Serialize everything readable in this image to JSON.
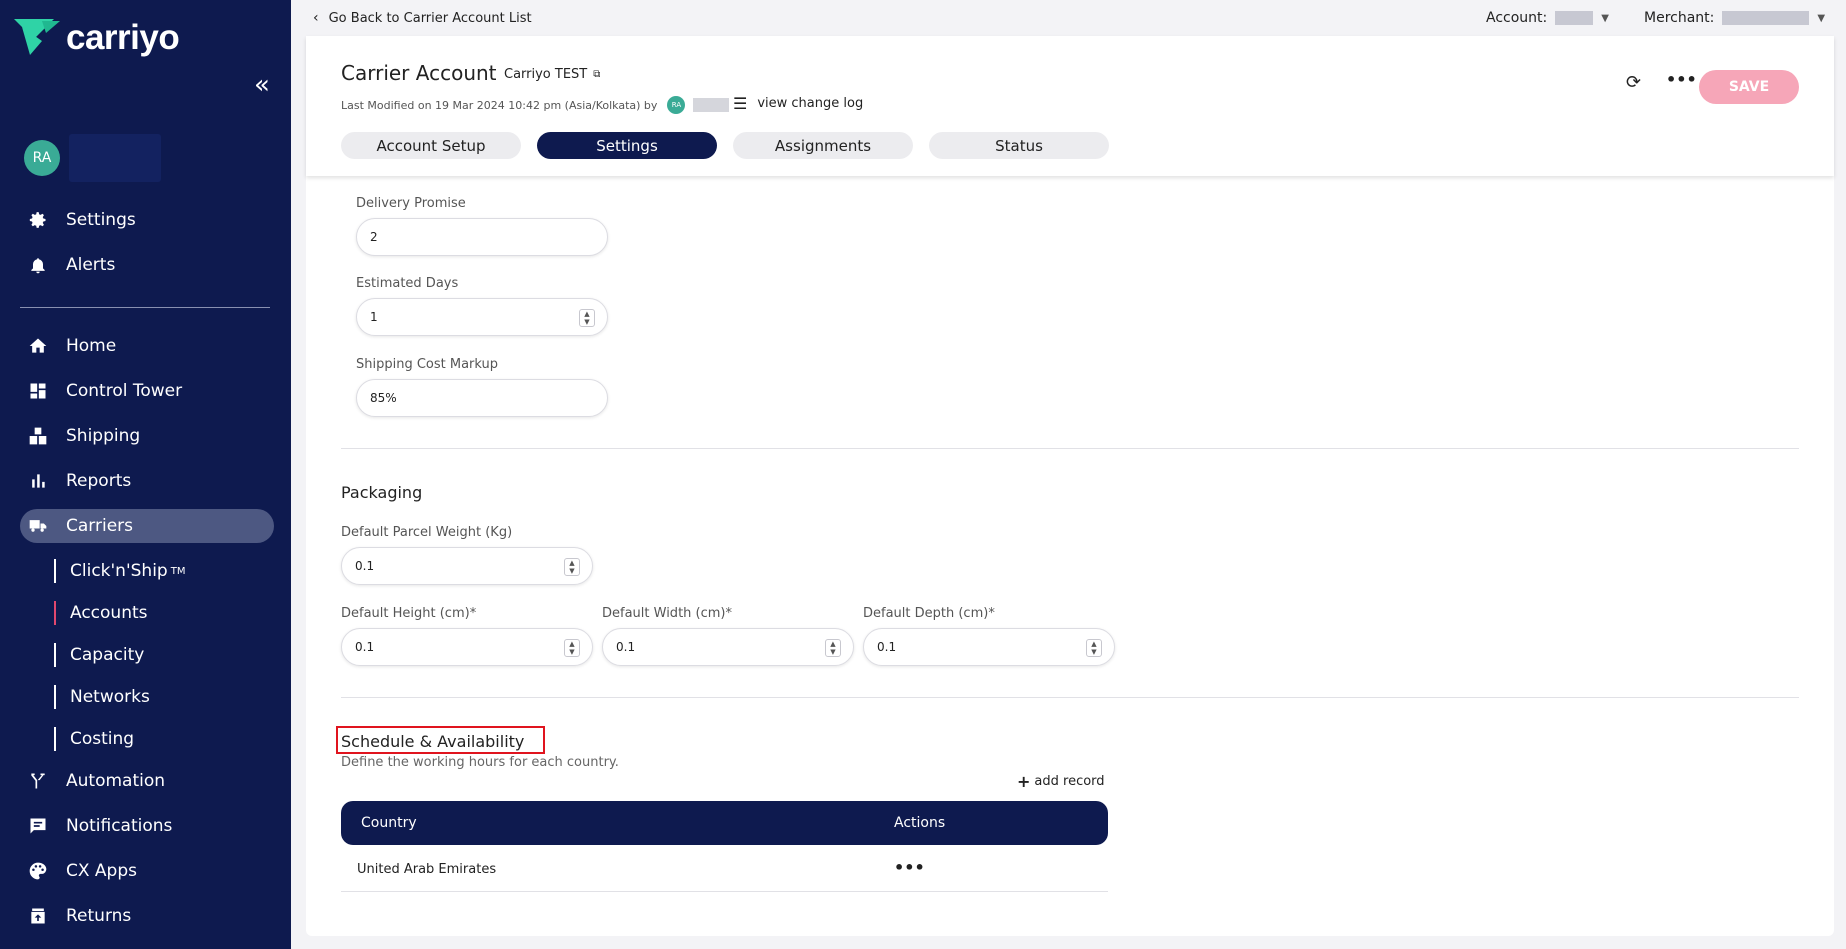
{
  "app": {
    "logo_text": "carriyo",
    "collapse_icon": "double-chevron-left-icon"
  },
  "user": {
    "initials": "RA"
  },
  "sidebar": {
    "top_items": [
      {
        "label": "Settings",
        "icon": "gear-icon"
      },
      {
        "label": "Alerts",
        "icon": "bell-icon"
      }
    ],
    "items": [
      {
        "label": "Home",
        "icon": "home-icon"
      },
      {
        "label": "Control Tower",
        "icon": "dashboard-icon"
      },
      {
        "label": "Shipping",
        "icon": "boxes-icon"
      },
      {
        "label": "Reports",
        "icon": "bar-chart-icon"
      },
      {
        "label": "Carriers",
        "icon": "truck-icon",
        "active": true
      }
    ],
    "sub_items": [
      {
        "label": "Click'n'Ship",
        "sup": "TM"
      },
      {
        "label": "Accounts",
        "active": true
      },
      {
        "label": "Capacity"
      },
      {
        "label": "Networks"
      },
      {
        "label": "Costing"
      }
    ],
    "bottom_items": [
      {
        "label": "Automation",
        "icon": "branch-icon"
      },
      {
        "label": "Notifications",
        "icon": "chat-icon"
      },
      {
        "label": "CX Apps",
        "icon": "palette-icon"
      },
      {
        "label": "Returns",
        "icon": "return-box-icon"
      }
    ]
  },
  "topbar": {
    "back_label": "Go Back to Carrier Account List",
    "account_label": "Account:",
    "merchant_label": "Merchant:"
  },
  "header": {
    "title": "Carrier Account",
    "subtitle": "Carriyo TEST",
    "modified": "Last Modified on 19 Mar 2024 10:42 pm (Asia/Kolkata) by",
    "modified_initials": "RA",
    "changelog_label": "view change log",
    "save_label": "SAVE",
    "tabs": [
      {
        "label": "Account Setup"
      },
      {
        "label": "Settings",
        "active": true
      },
      {
        "label": "Assignments"
      },
      {
        "label": "Status"
      }
    ]
  },
  "delivery": {
    "promise_label": "Delivery Promise",
    "promise_value": "2",
    "estimated_label": "Estimated Days",
    "estimated_value": "1",
    "markup_label": "Shipping Cost Markup",
    "markup_value": "85%"
  },
  "packaging": {
    "title": "Packaging",
    "weight_label": "Default Parcel Weight (Kg)",
    "weight_value": "0.1",
    "height_label": "Default Height (cm)*",
    "height_value": "0.1",
    "width_label": "Default Width (cm)*",
    "width_value": "0.1",
    "depth_label": "Default Depth (cm)*",
    "depth_value": "0.1"
  },
  "schedule": {
    "title": "Schedule & Availability",
    "description": "Define the working hours for each country.",
    "add_record_label": "add record",
    "columns": {
      "country": "Country",
      "actions": "Actions"
    },
    "rows": [
      {
        "country": "United Arab Emirates"
      }
    ]
  },
  "colors": {
    "sidebar_bg": "#0e1a4f",
    "accent_pink": "#e0486f",
    "save_bg": "#f6a6b8",
    "avatar_teal": "#3aab96",
    "highlight_red": "#e0141e"
  }
}
